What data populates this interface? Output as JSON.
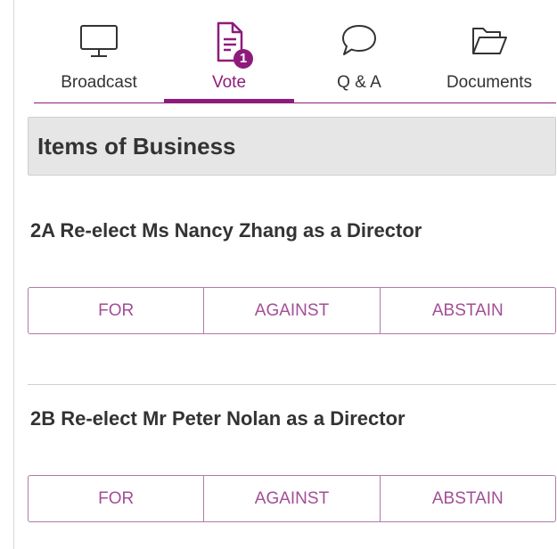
{
  "colors": {
    "accent": "#8e1b7c",
    "text": "#333333",
    "header_bg": "#e6e6e6",
    "button_text": "#a34e96"
  },
  "tabs": [
    {
      "label": "Broadcast",
      "icon": "monitor-icon",
      "active": false
    },
    {
      "label": "Vote",
      "icon": "document-icon",
      "active": true,
      "badge": "1"
    },
    {
      "label": "Q & A",
      "icon": "speech-bubble-icon",
      "active": false
    },
    {
      "label": "Documents",
      "icon": "folder-open-icon",
      "active": false
    }
  ],
  "section": {
    "title": "Items of Business"
  },
  "items": [
    {
      "title": "2A Re-elect Ms Nancy Zhang as a Director",
      "options": [
        "FOR",
        "AGAINST",
        "ABSTAIN"
      ]
    },
    {
      "title": "2B Re-elect Mr Peter Nolan as a Director",
      "options": [
        "FOR",
        "AGAINST",
        "ABSTAIN"
      ]
    }
  ]
}
